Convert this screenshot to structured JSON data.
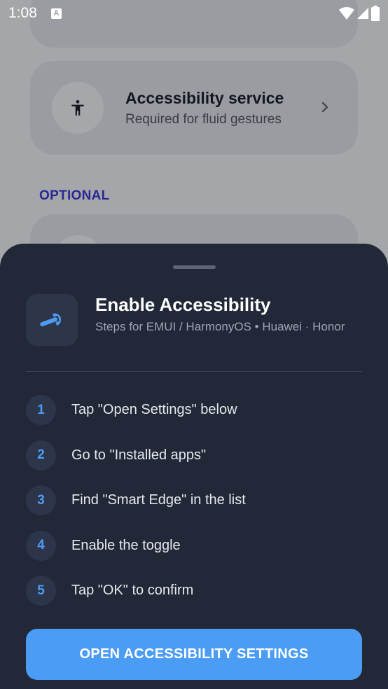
{
  "status_bar": {
    "time": "1:08",
    "notification_letter": "A",
    "icons": [
      "wifi-icon",
      "cell-signal-icon",
      "battery-icon"
    ]
  },
  "background": {
    "service_card": {
      "title": "Accessibility service",
      "subtitle": "Required for fluid gestures",
      "icon": "accessibility-person-icon"
    },
    "section_label": "OPTIONAL"
  },
  "sheet": {
    "icon": "wrench-icon",
    "title": "Enable Accessibility",
    "subtitle": "Steps for EMUI / HarmonyOS  •  Huawei · Honor",
    "steps": [
      {
        "num": "1",
        "text": "Tap \"Open Settings\" below"
      },
      {
        "num": "2",
        "text": "Go to \"Installed apps\""
      },
      {
        "num": "3",
        "text": "Find \"Smart Edge\" in the list"
      },
      {
        "num": "4",
        "text": "Enable the toggle"
      },
      {
        "num": "5",
        "text": "Tap \"OK\" to confirm"
      }
    ],
    "cta_label": "OPEN ACCESSIBILITY SETTINGS"
  },
  "colors": {
    "accent": "#4b9cf5",
    "sheet_bg": "#222837",
    "section_label": "#3d3ad6"
  }
}
